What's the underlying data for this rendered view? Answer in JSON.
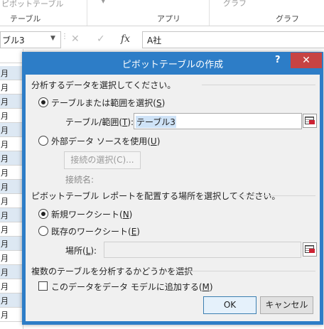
{
  "ribbon": {
    "item_pivot": "ピボットテーブル",
    "group_table": "テーブル",
    "group_apps": "アプリ",
    "group_graph": "グラフ",
    "item_graph": "グラフ"
  },
  "formula_bar": {
    "name_box": "ブル3",
    "cancel_symbol": "✕",
    "enter_symbol": "✓",
    "fx_symbol": "fx",
    "content": "A社"
  },
  "sheet": {
    "row_label": "月"
  },
  "dialog": {
    "title": "ピボットテーブルの作成",
    "help": "?",
    "close": "✕",
    "section1_label": "分析するデータを選択してください。",
    "radio_table_label": "テーブルまたは範囲を選択(",
    "radio_table_key": "S",
    "table_range_label": "テーブル/範囲(",
    "table_range_key": "T",
    "table_range_value": "テーブル3",
    "radio_external_label": "外部データ ソースを使用(",
    "radio_external_key": "U",
    "choose_connection_button": "接続の選択(C)...",
    "connection_name_label": "接続名:",
    "section2_label": "ピボットテーブル レポートを配置する場所を選択してください。",
    "radio_new_sheet_label": "新規ワークシート(",
    "radio_new_sheet_key": "N",
    "radio_existing_sheet_label": "既存のワークシート(",
    "radio_existing_sheet_key": "E",
    "location_label": "場所(",
    "location_key": "L",
    "location_value": "",
    "section3_label": "複数のテーブルを分析するかどうかを選択",
    "add_to_model_label": "このデータをデータ モデルに追加する(",
    "add_to_model_key": "M",
    "ok_button": "OK",
    "cancel_button": "キャンセル",
    "selected_source": "テーブルまたは範囲を選択",
    "selected_destination": "新規ワークシート",
    "add_to_model_checked": false
  },
  "colors": {
    "accent": "#2d7dc7",
    "close_red": "#c74343",
    "dialog_bg": "#f0f0f0"
  }
}
